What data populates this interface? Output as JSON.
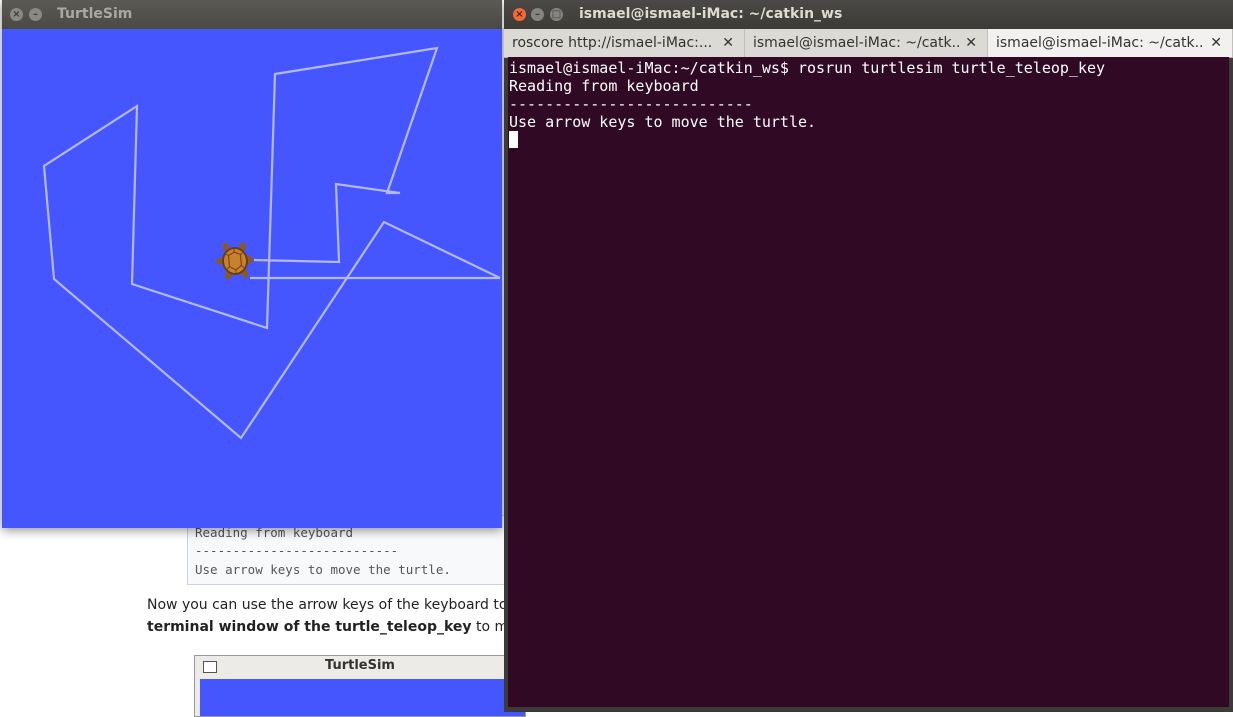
{
  "background_page": {
    "code_lines": [
      "Reading from keyboard",
      "---------------------------",
      "Use arrow keys to move the turtle."
    ],
    "paragraph_line1": "Now you can use the arrow keys of the keyboard to drive",
    "paragraph_bold": "terminal window of the turtle_teleop_key",
    "paragraph_line2_rest": " to make sur",
    "mini_window_title": "TurtleSim"
  },
  "turtlesim_window": {
    "title": "TurtleSim",
    "canvas_color": "#4556ff",
    "path_color": "#b3b8ff",
    "close_icon": "close-icon",
    "minimize_icon": "minimize-icon",
    "turtle_icon": "turtle-icon"
  },
  "terminal_window": {
    "title": "ismael@ismael-iMac: ~/catkin_ws",
    "tabs": [
      {
        "label": "roscore http://ismael-iMac:...",
        "active": false
      },
      {
        "label": "ismael@ismael-iMac: ~/catk...",
        "active": false
      },
      {
        "label": "ismael@ismael-iMac: ~/catk...",
        "active": true
      }
    ],
    "lines": [
      "ismael@ismael-iMac:~/catkin_ws$ rosrun turtlesim turtle_teleop_key",
      "Reading from keyboard",
      "---------------------------",
      "Use arrow keys to move the turtle."
    ],
    "background_color": "#300a24"
  }
}
